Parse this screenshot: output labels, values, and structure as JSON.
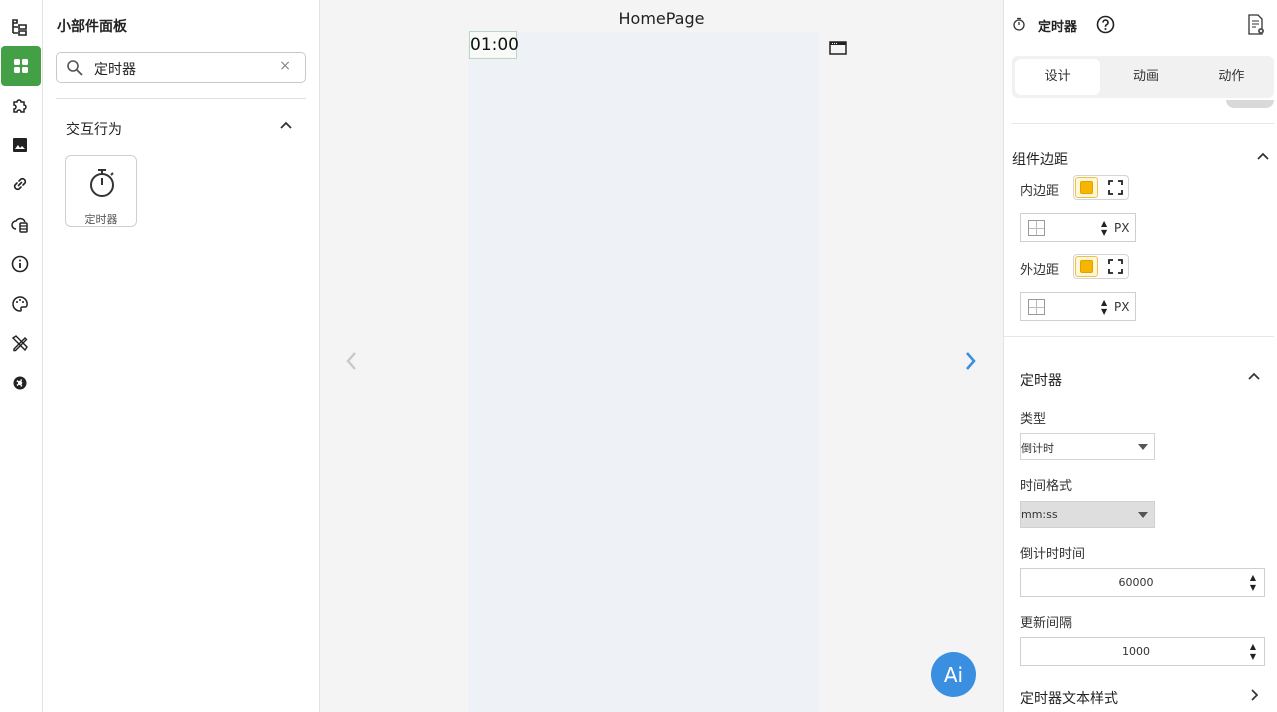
{
  "widget_panel": {
    "title": "小部件面板",
    "search": {
      "value": "定时器",
      "clear": "×"
    },
    "group": {
      "title": "交互行为"
    },
    "widgets": [
      {
        "label": "定时器",
        "icon": "stopwatch-icon"
      }
    ]
  },
  "rail": {
    "items": [
      {
        "icon": "tree-structure-icon"
      },
      {
        "icon": "widgets-icon",
        "active": true
      },
      {
        "icon": "puzzle-icon"
      },
      {
        "icon": "image-icon"
      },
      {
        "icon": "link-icon"
      },
      {
        "icon": "cloud-database-icon"
      },
      {
        "icon": "info-icon"
      },
      {
        "icon": "palette-icon"
      },
      {
        "icon": "design-tools-icon"
      },
      {
        "icon": "settings-icon"
      }
    ],
    "active_color": "#43a047"
  },
  "canvas": {
    "page_title": "HomePage",
    "timer_text": "01:00",
    "ai_label": "Ai",
    "accent": "#3a8fe0"
  },
  "props": {
    "title": "定时器",
    "tabs": [
      "设计",
      "动画",
      "动作"
    ],
    "active_tab": "设计",
    "margin_section": {
      "title": "组件边距",
      "padding_label": "内边距",
      "margin_label": "外边距",
      "unit": "PX"
    },
    "timer_section": {
      "title": "定时器",
      "type_label": "类型",
      "type_value": "倒计时",
      "format_label": "时间格式",
      "format_value": "mm:ss",
      "countdown_label": "倒计时时间",
      "countdown_value": "60000",
      "interval_label": "更新间隔",
      "interval_value": "1000"
    },
    "text_style_section": {
      "title": "定时器文本样式"
    }
  }
}
